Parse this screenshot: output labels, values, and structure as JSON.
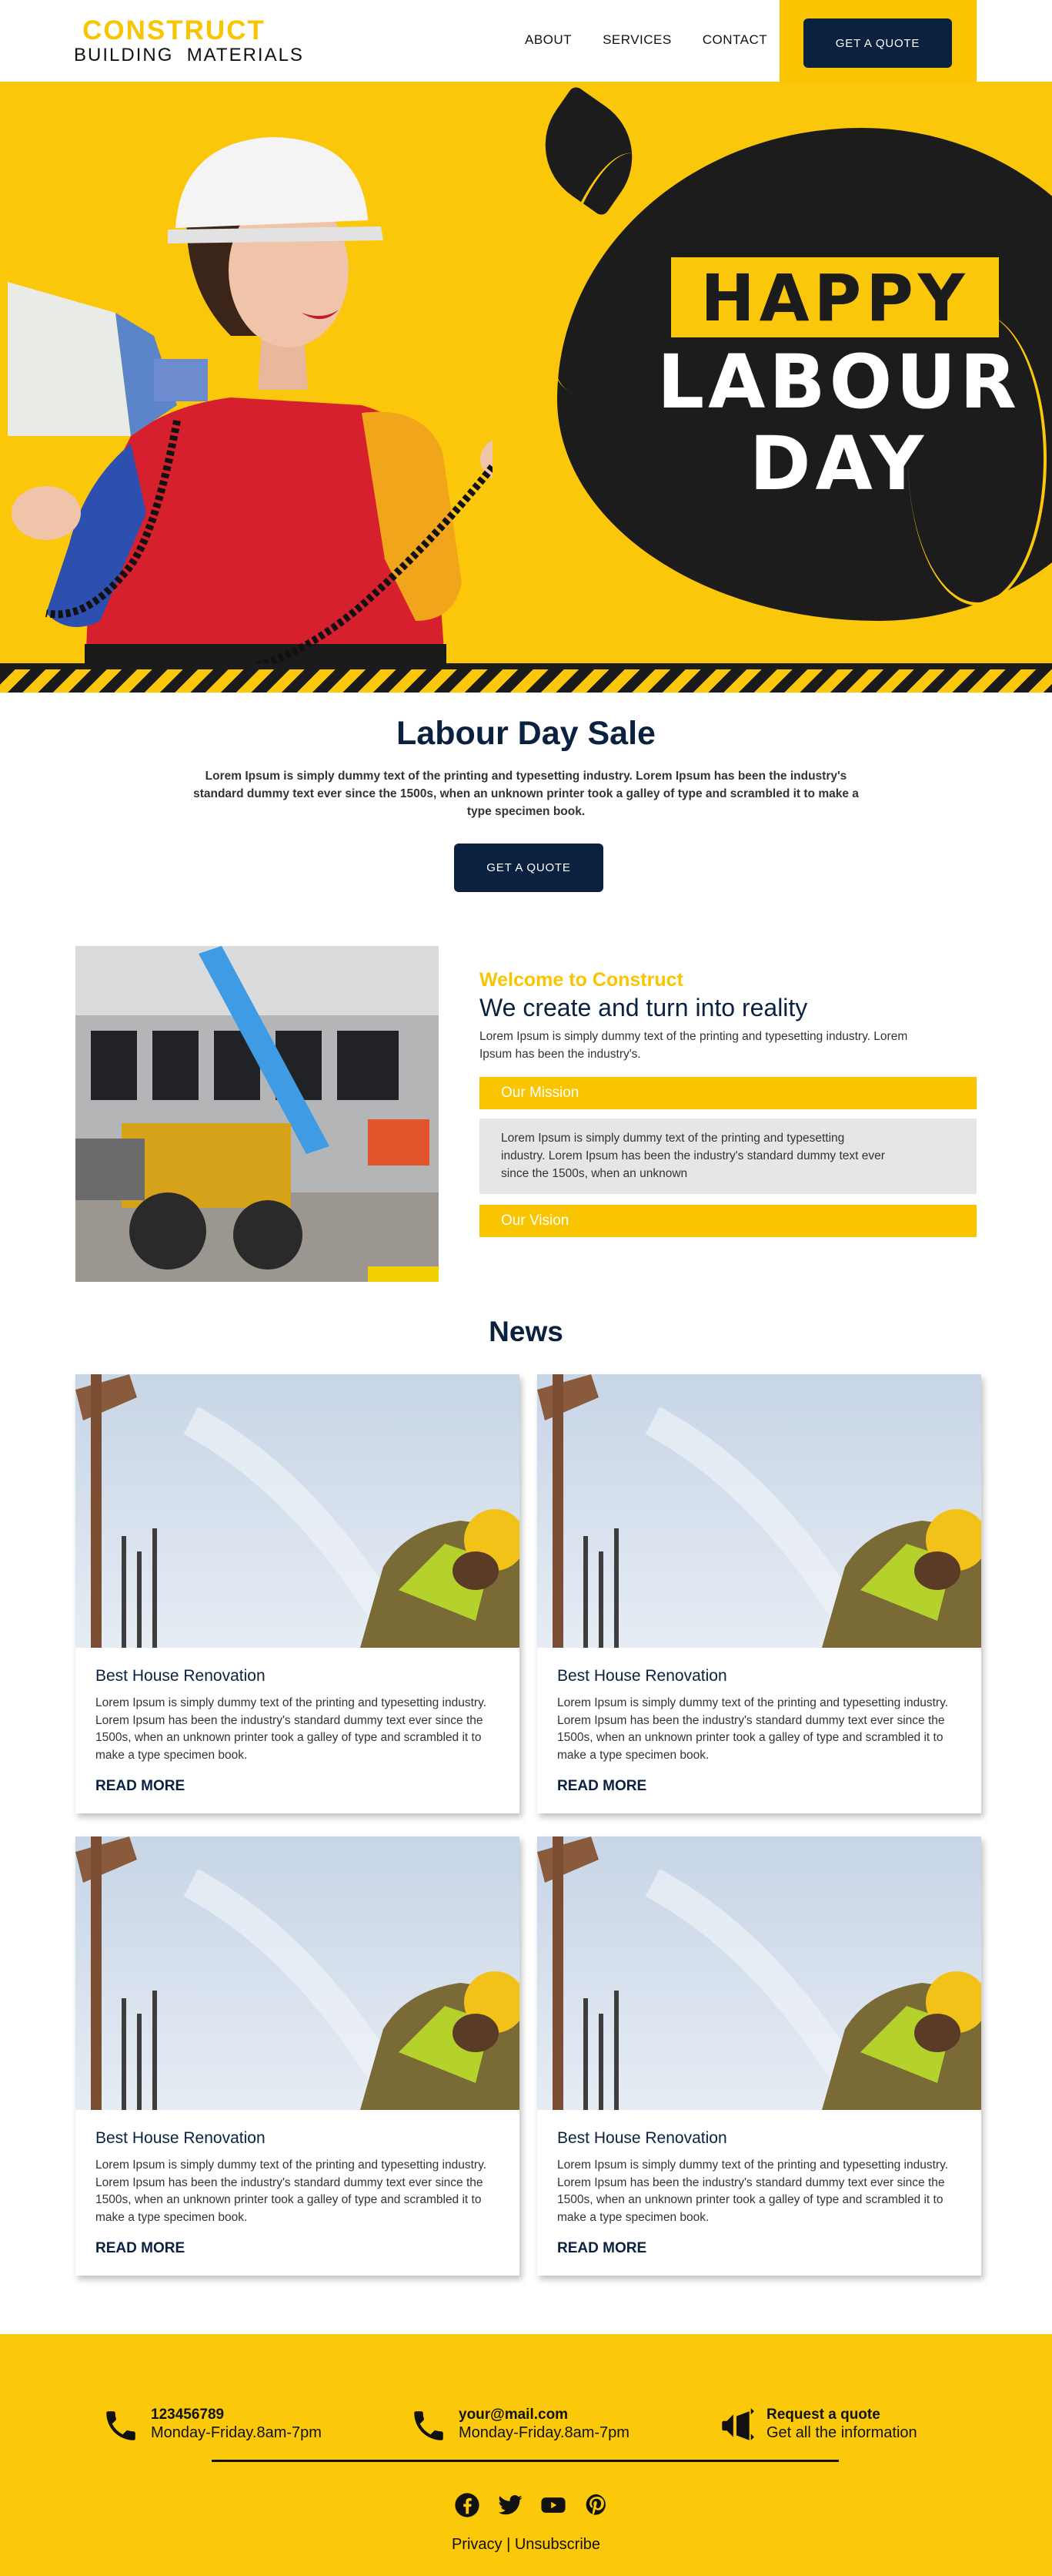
{
  "header": {
    "logo_top": "CONSTRUCT",
    "logo_bottom": "BUILDING  MATERIALS",
    "nav": [
      "ABOUT",
      "SERVICES",
      "CONTACT"
    ],
    "quote_button": "GET A QUOTE"
  },
  "hero": {
    "line1": "HAPPY",
    "line2": "LABOUR",
    "line3": "DAY"
  },
  "sale": {
    "title": "Labour Day Sale",
    "text": "Lorem Ipsum is simply dummy text of the printing and typesetting industry. Lorem Ipsum has been the industry's standard dummy text ever since the 1500s, when an unknown printer took a galley of type and scrambled it to make a type specimen book.",
    "button": "GET A QUOTE"
  },
  "welcome": {
    "kicker": "Welcome to Construct",
    "title": "We create and turn into reality",
    "text": "Lorem Ipsum is simply dummy text of the printing and typesetting industry. Lorem Ipsum has been the industry's.",
    "mission_label": "Our Mission",
    "mission_text": "Lorem Ipsum is simply dummy text of the printing and typesetting industry. Lorem Ipsum has been the industry's standard dummy text ever since the 1500s, when an unknown",
    "vision_label": "Our Vision"
  },
  "news": {
    "title": "News",
    "cards": [
      {
        "title": "Best House Renovation",
        "text": "Lorem Ipsum is simply dummy text of the printing and typesetting industry. Lorem Ipsum has been the industry's standard dummy text ever since the 1500s, when an unknown printer took a galley of type and scrambled it to make a type specimen book.",
        "link": "READ MORE"
      },
      {
        "title": "Best House Renovation",
        "text": "Lorem Ipsum is simply dummy text of the printing and typesetting industry. Lorem Ipsum has been the industry's standard dummy text ever since the 1500s, when an unknown printer took a galley of type and scrambled it to make a type specimen book.",
        "link": "READ MORE"
      },
      {
        "title": "Best House Renovation",
        "text": "Lorem Ipsum is simply dummy text of the printing and typesetting industry. Lorem Ipsum has been the industry's standard dummy text ever since the 1500s, when an unknown printer took a galley of type and scrambled it to make a type specimen book.",
        "link": "READ MORE"
      },
      {
        "title": "Best House Renovation",
        "text": "Lorem Ipsum is simply dummy text of the printing and typesetting industry. Lorem Ipsum has been the industry's standard dummy text ever since the 1500s, when an unknown printer took a galley of type and scrambled it to make a type specimen book.",
        "link": "READ MORE"
      }
    ]
  },
  "footer": {
    "phone": {
      "bold": "123456789",
      "line": "Monday-Friday.8am-7pm",
      "icon": "phone-icon"
    },
    "email": {
      "bold": "your@mail.com",
      "line": "Monday-Friday.8am-7pm",
      "icon": "phone-icon"
    },
    "quote": {
      "bold": "Request a quote",
      "line": "Get all the information",
      "icon": "megaphone-icon"
    },
    "socials": [
      "facebook-icon",
      "twitter-icon",
      "youtube-icon",
      "pinterest-icon"
    ],
    "privacy": "Privacy",
    "separator": "|",
    "unsubscribe": "Unsubscribe"
  },
  "colors": {
    "accent_yellow": "#f9c400",
    "navy": "#0a2240",
    "dark": "#1c1c1c"
  }
}
